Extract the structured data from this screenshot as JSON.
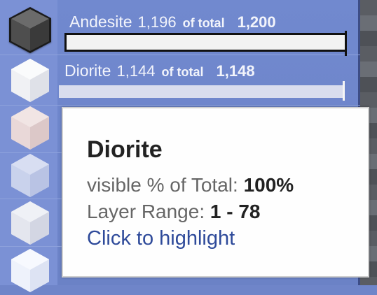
{
  "rows": [
    {
      "name": "Andesite",
      "count": "1,196",
      "of_total": "of total",
      "total": "1,200",
      "selected": true,
      "cube_icon": "andesite-block-icon",
      "cube_color": "#4a4a4a"
    },
    {
      "name": "Diorite",
      "count": "1,144",
      "of_total": "of total",
      "total": "1,148",
      "selected": false,
      "cube_icon": "diorite-block-icon",
      "cube_color": "#e6e8ef"
    }
  ],
  "extra_cubes": [
    {
      "cube_icon": "granite-block-icon",
      "cube_color": "#e9d8d8"
    },
    {
      "cube_icon": "block-icon",
      "cube_color": "#c9d2ec"
    },
    {
      "cube_icon": "block-icon",
      "cube_color": "#e4e6ee"
    },
    {
      "cube_icon": "block-icon",
      "cube_color": "#eef2fb"
    }
  ],
  "tooltip": {
    "title": "Diorite",
    "visible_label": "visible % of Total:",
    "visible_value": "100%",
    "range_label": "Layer Range:",
    "range_value": "1 - 78",
    "link": "Click to highlight"
  },
  "colors": {
    "link": "#2e4a9a",
    "panel": "#7189cf"
  }
}
